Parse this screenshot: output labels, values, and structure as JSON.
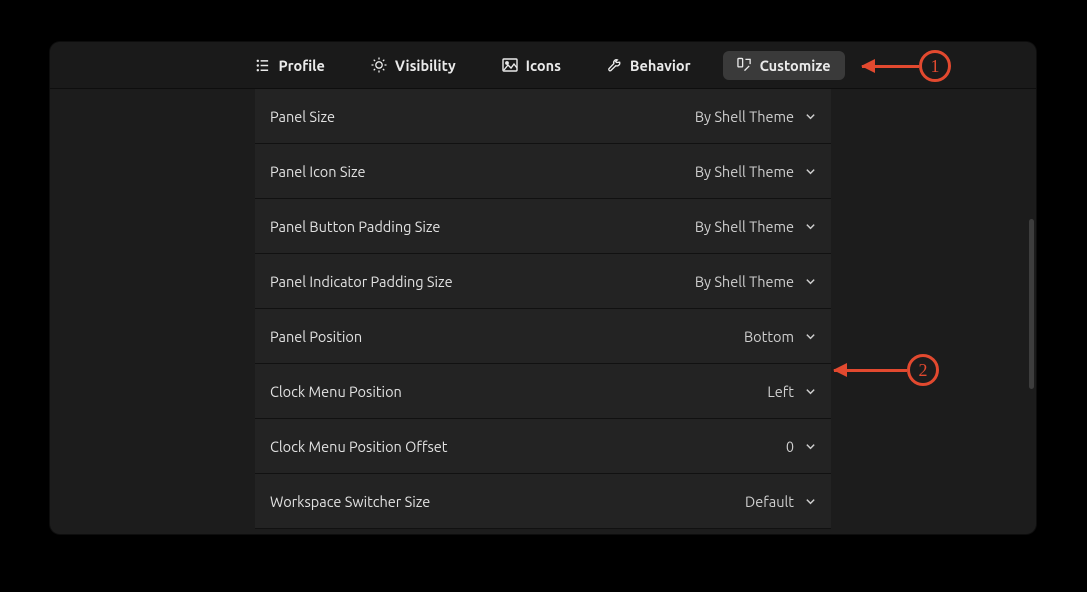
{
  "tabs": [
    {
      "label": "Profile"
    },
    {
      "label": "Visibility"
    },
    {
      "label": "Icons"
    },
    {
      "label": "Behavior"
    },
    {
      "label": "Customize"
    }
  ],
  "active_tab_index": 4,
  "settings": [
    {
      "label": "Panel Size",
      "value": "By Shell Theme"
    },
    {
      "label": "Panel Icon Size",
      "value": "By Shell Theme"
    },
    {
      "label": "Panel Button Padding Size",
      "value": "By Shell Theme"
    },
    {
      "label": "Panel Indicator Padding Size",
      "value": "By Shell Theme"
    },
    {
      "label": "Panel Position",
      "value": "Bottom"
    },
    {
      "label": "Clock Menu Position",
      "value": "Left"
    },
    {
      "label": "Clock Menu Position Offset",
      "value": "0"
    },
    {
      "label": "Workspace Switcher Size",
      "value": "Default"
    }
  ],
  "annotations": {
    "marker1": "1",
    "marker2": "2"
  }
}
